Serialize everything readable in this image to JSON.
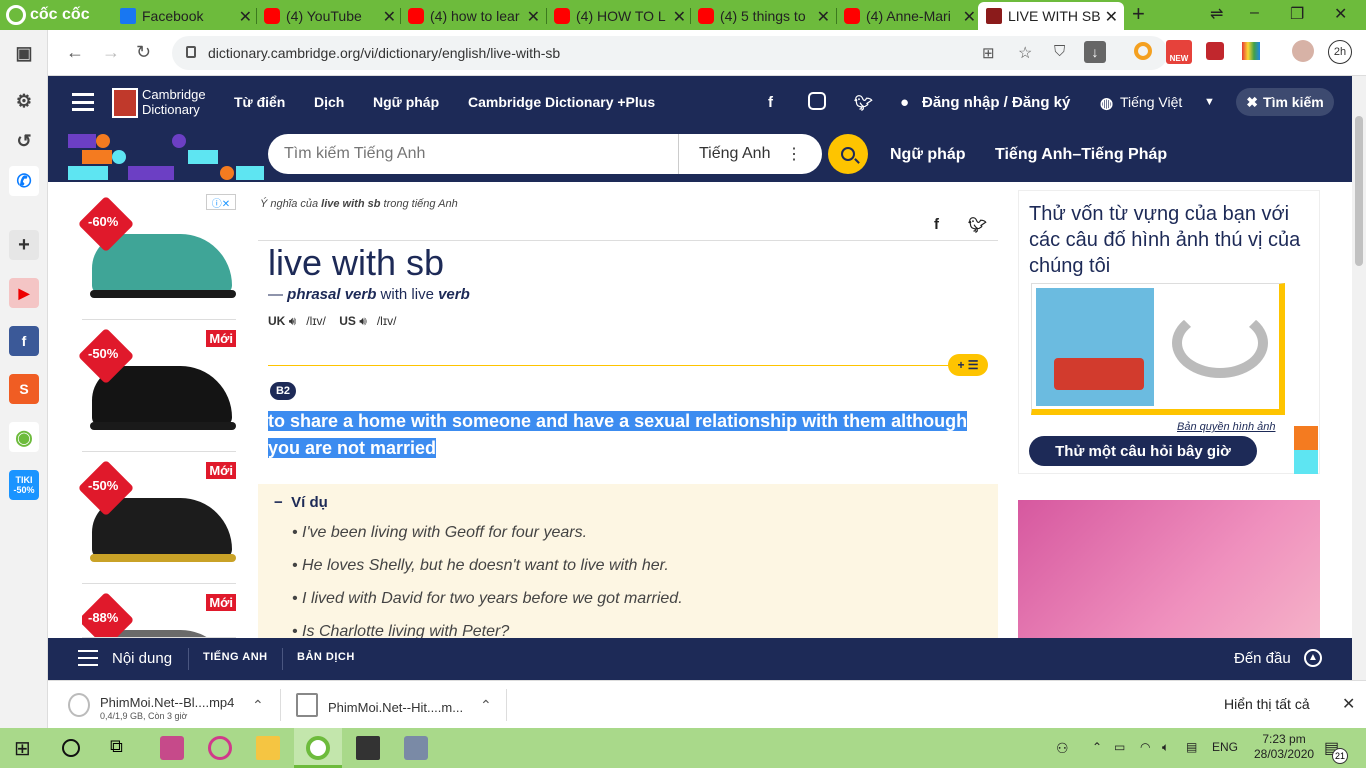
{
  "browser": {
    "brand": "cốc cốc",
    "tabs": [
      {
        "title": "Facebook",
        "icon": "facebook-icon"
      },
      {
        "title": "(4) YouTube",
        "icon": "youtube-icon"
      },
      {
        "title": "(4) how to lear",
        "icon": "youtube-icon"
      },
      {
        "title": "(4) HOW TO L",
        "icon": "youtube-icon"
      },
      {
        "title": "(4) 5 things to",
        "icon": "youtube-icon"
      },
      {
        "title": "(4) Anne-Mari",
        "icon": "youtube-icon"
      },
      {
        "title": "LIVE WITH SB",
        "icon": "cambridge-icon"
      }
    ],
    "new_tab": "+",
    "url": "dictionary.cambridge.org/vi/dictionary/english/live-with-sb",
    "profile_time": "2h"
  },
  "sidebar": {
    "tiki_badge": "TIKI -50%"
  },
  "header": {
    "brand_line1": "Cambridge",
    "brand_line2": "Dictionary",
    "menu": [
      "Từ điển",
      "Dịch",
      "Ngữ pháp",
      "Cambridge Dictionary +Plus"
    ],
    "login": "Đăng nhập / Đăng ký",
    "language": "Tiếng Việt",
    "search_button": "Tìm kiếm"
  },
  "searchbar": {
    "placeholder": "Tìm kiếm Tiếng Anh",
    "dictionary": "Tiếng Anh",
    "links": [
      "Ngữ pháp",
      "Tiếng Anh–Tiếng Pháp"
    ]
  },
  "ads_left": [
    {
      "discount": "-60%",
      "badge": "",
      "color": "#3fa597"
    },
    {
      "discount": "-50%",
      "badge": "Mới",
      "color": "#141414"
    },
    {
      "discount": "-50%",
      "badge": "Mới",
      "color": "#1c1c1c"
    },
    {
      "discount": "-88%",
      "badge": "Mới",
      "color": "#6a6a6a"
    }
  ],
  "entry": {
    "breadcrumb_pre": "Ý nghĩa của ",
    "breadcrumb_word": "live with sb",
    "breadcrumb_post": " trong tiếng Anh",
    "headword": "live with sb",
    "pos_dash": "— ",
    "pos": "phrasal verb",
    "pos_with": " with live ",
    "pos_verb": "verb",
    "uk_label": "UK",
    "uk_ipa": "/lɪv/",
    "us_label": "US",
    "us_ipa": "/lɪv/",
    "level": "B2",
    "definition_line1": "to share a home with someone and have a sexual relationship with them although",
    "definition_line2": "you are not married",
    "examples_heading": "Ví dụ",
    "examples": [
      "I've been living with Geoff for four years.",
      "He loves Shelly, but he doesn't want to live with her.",
      "I lived with David for two years before we got married.",
      "Is Charlotte living with Peter?"
    ]
  },
  "quiz": {
    "title": "Thử vốn từ vựng của bạn với các câu đố hình ảnh thú vị của chúng tôi",
    "copyright": "Bản quyền hình ảnh",
    "button": "Thử một câu hỏi bây giờ"
  },
  "content_bar": {
    "contents": "Nội dung",
    "tab1": "TIẾNG ANH",
    "tab2": "BẢN DỊCH",
    "to_top": "Đến đầu"
  },
  "downloads": {
    "items": [
      {
        "name": "PhimMoi.Net--Bl....mp4",
        "sub": "0,4/1,9 GB, Còn 3 giờ"
      },
      {
        "name": "PhimMoi.Net--Hit....m...",
        "sub": ""
      }
    ],
    "show_all": "Hiển thị tất cả"
  },
  "taskbar": {
    "lang": "ENG",
    "time": "7:23 pm",
    "date": "28/03/2020",
    "notif_count": "21"
  },
  "colors": {
    "cambridge_navy": "#1d2a57",
    "cambridge_yellow": "#fec400",
    "browser_green": "#6dbb3c",
    "highlight": "#3c8cf0"
  }
}
